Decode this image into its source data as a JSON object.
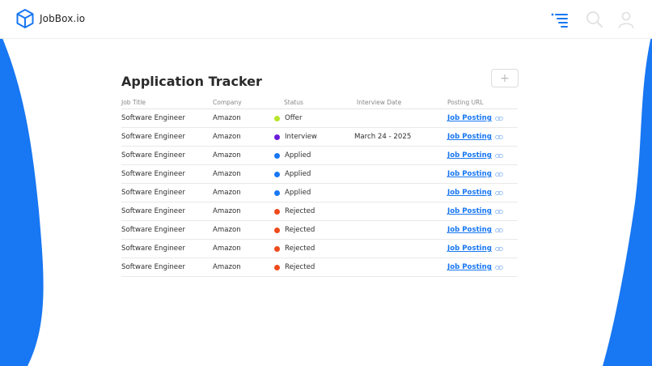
{
  "brand": {
    "name": "JobBox.io"
  },
  "page": {
    "title": "Application Tracker",
    "add_label": "+"
  },
  "colors": {
    "accent": "#1877f2",
    "offer": "#b8e62c",
    "interview": "#6a1bd8",
    "applied": "#1877f2",
    "rejected": "#ee4a1c"
  },
  "icons": {
    "brand": "cube-icon",
    "menu": "menu-lines-icon",
    "search": "search-icon",
    "user": "user-icon",
    "link": "link-icon"
  },
  "table": {
    "headers": [
      "Job Title",
      "Company",
      "Status",
      "Interview Date",
      "Posting URL"
    ],
    "rows": [
      {
        "title": "Software Engineer",
        "company": "Amazon",
        "status": "Offer",
        "status_color": "#b8e62c",
        "date": "",
        "url_label": "Job Posting"
      },
      {
        "title": "Software Engineer",
        "company": "Amazon",
        "status": "Interview",
        "status_color": "#6a1bd8",
        "date": "March 24 - 2025",
        "url_label": "Job Posting"
      },
      {
        "title": "Software Engineer",
        "company": "Amazon",
        "status": "Applied",
        "status_color": "#1877f2",
        "date": "",
        "url_label": "Job Posting"
      },
      {
        "title": "Software Engineer",
        "company": "Amazon",
        "status": "Applied",
        "status_color": "#1877f2",
        "date": "",
        "url_label": "Job Posting"
      },
      {
        "title": "Software Engineer",
        "company": "Amazon",
        "status": "Applied",
        "status_color": "#1877f2",
        "date": "",
        "url_label": "Job Posting"
      },
      {
        "title": "Software Engineer",
        "company": "Amazon",
        "status": "Rejected",
        "status_color": "#ee4a1c",
        "date": "",
        "url_label": "Job Posting"
      },
      {
        "title": "Software Engineer",
        "company": "Amazon",
        "status": "Rejected",
        "status_color": "#ee4a1c",
        "date": "",
        "url_label": "Job Posting"
      },
      {
        "title": "Software Engineer",
        "company": "Amazon",
        "status": "Rejected",
        "status_color": "#ee4a1c",
        "date": "",
        "url_label": "Job Posting"
      },
      {
        "title": "Software Engineer",
        "company": "Amazon",
        "status": "Rejected",
        "status_color": "#ee4a1c",
        "date": "",
        "url_label": "Job Posting"
      }
    ]
  }
}
